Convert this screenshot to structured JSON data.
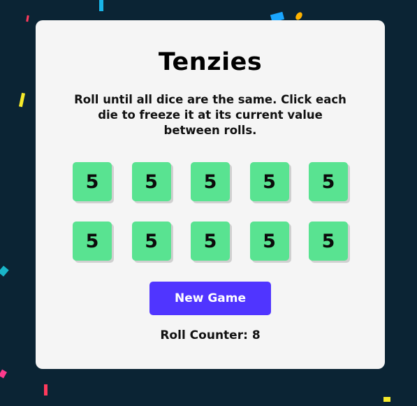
{
  "game": {
    "title": "Tenzies",
    "instructions": "Roll until all dice are the same. Click each die to freeze it at its current value between rolls.",
    "dice": [
      "5",
      "5",
      "5",
      "5",
      "5",
      "5",
      "5",
      "5",
      "5",
      "5"
    ],
    "new_game_label": "New Game",
    "roll_counter_label": "Roll Counter:",
    "roll_count": "8"
  },
  "colors": {
    "background": "#0b2434",
    "card": "#f5f5f5",
    "die_held": "#59e391",
    "button": "#5035ff"
  }
}
